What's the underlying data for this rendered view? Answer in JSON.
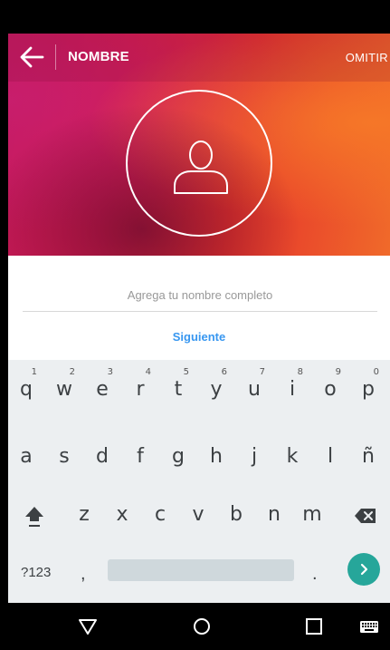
{
  "header": {
    "title": "NOMBRE",
    "skip_label": "OMITIR"
  },
  "form": {
    "name_placeholder": "Agrega tu nombre completo",
    "name_value": "",
    "next_label": "Siguiente"
  },
  "keyboard": {
    "row1": [
      {
        "ch": "q",
        "hint": "1"
      },
      {
        "ch": "w",
        "hint": "2"
      },
      {
        "ch": "e",
        "hint": "3"
      },
      {
        "ch": "r",
        "hint": "4"
      },
      {
        "ch": "t",
        "hint": "5"
      },
      {
        "ch": "y",
        "hint": "6"
      },
      {
        "ch": "u",
        "hint": "7"
      },
      {
        "ch": "i",
        "hint": "8"
      },
      {
        "ch": "o",
        "hint": "9"
      },
      {
        "ch": "p",
        "hint": "0"
      }
    ],
    "row2": [
      "a",
      "s",
      "d",
      "f",
      "g",
      "h",
      "j",
      "k",
      "l",
      "ñ"
    ],
    "row3": [
      "z",
      "x",
      "c",
      "v",
      "b",
      "n",
      "m"
    ],
    "symbols_label": "?123",
    "comma_label": ",",
    "period_label": "."
  },
  "icons": {
    "back": "arrow-left-icon",
    "avatar": "user-outline-icon",
    "shift": "shift-icon",
    "backspace": "backspace-icon",
    "enter": "chevron-right-icon",
    "nav_back": "triangle-back-icon",
    "nav_home": "circle-home-icon",
    "nav_recents": "square-recents-icon",
    "nav_keyboard": "keyboard-icon"
  },
  "colors": {
    "accent_link": "#3897f0",
    "enter_button": "#26a69a",
    "keyboard_bg": "#eceff1"
  }
}
